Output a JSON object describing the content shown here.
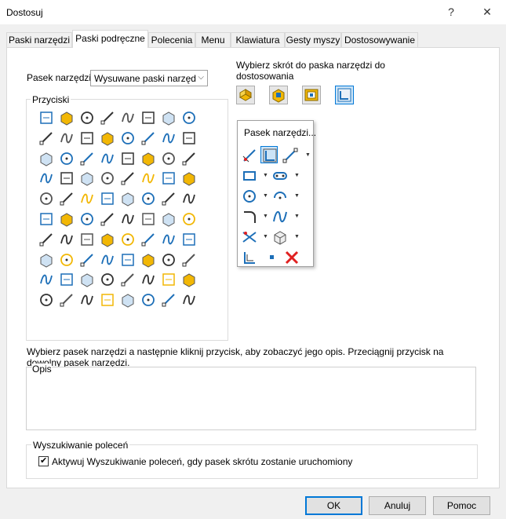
{
  "window": {
    "title": "Dostosuj",
    "help_glyph": "?",
    "close_glyph": "✕"
  },
  "tabs": [
    {
      "label": "Paski narzędzi"
    },
    {
      "label": "Paski podręczne"
    },
    {
      "label": "Polecenia"
    },
    {
      "label": "Menu"
    },
    {
      "label": "Klawiatura"
    },
    {
      "label": "Gesty myszy"
    },
    {
      "label": "Dostosowywanie"
    }
  ],
  "toolbar_select": {
    "label": "Pasek narzędzi:",
    "value": "Wysuwane paski narzęd"
  },
  "quick_section": {
    "label": "Wybierz skrót do paska narzędzi do dostosowania",
    "label_line1": "Wybierz skrót do paska narzędzi do",
    "label_line2": "dostosowania"
  },
  "buttons_group": {
    "title": "Przyciski"
  },
  "popup": {
    "title": "Pasek narzędzi..."
  },
  "instructions": {
    "line1": "Wybierz pasek narzędzi a następnie kliknij przycisk, aby zobaczyć jego opis. Przeciągnij przycisk na",
    "line2": "dowolny pasek narzędzi."
  },
  "description": {
    "title": "Opis",
    "value": ""
  },
  "search_group": {
    "title": "Wyszukiwanie poleceń",
    "checkbox_label": "Aktywuj Wyszukiwanie poleceń, gdy pasek skrótu zostanie uruchomiony",
    "checked": true
  },
  "footer": {
    "ok": "OK",
    "cancel": "Anuluj",
    "help": "Pomoc"
  },
  "colors": {
    "accent": "#0078d7",
    "icon_yellow": "#f2b705",
    "icon_blue": "#1d6fb8",
    "delete_red": "#e02020"
  }
}
